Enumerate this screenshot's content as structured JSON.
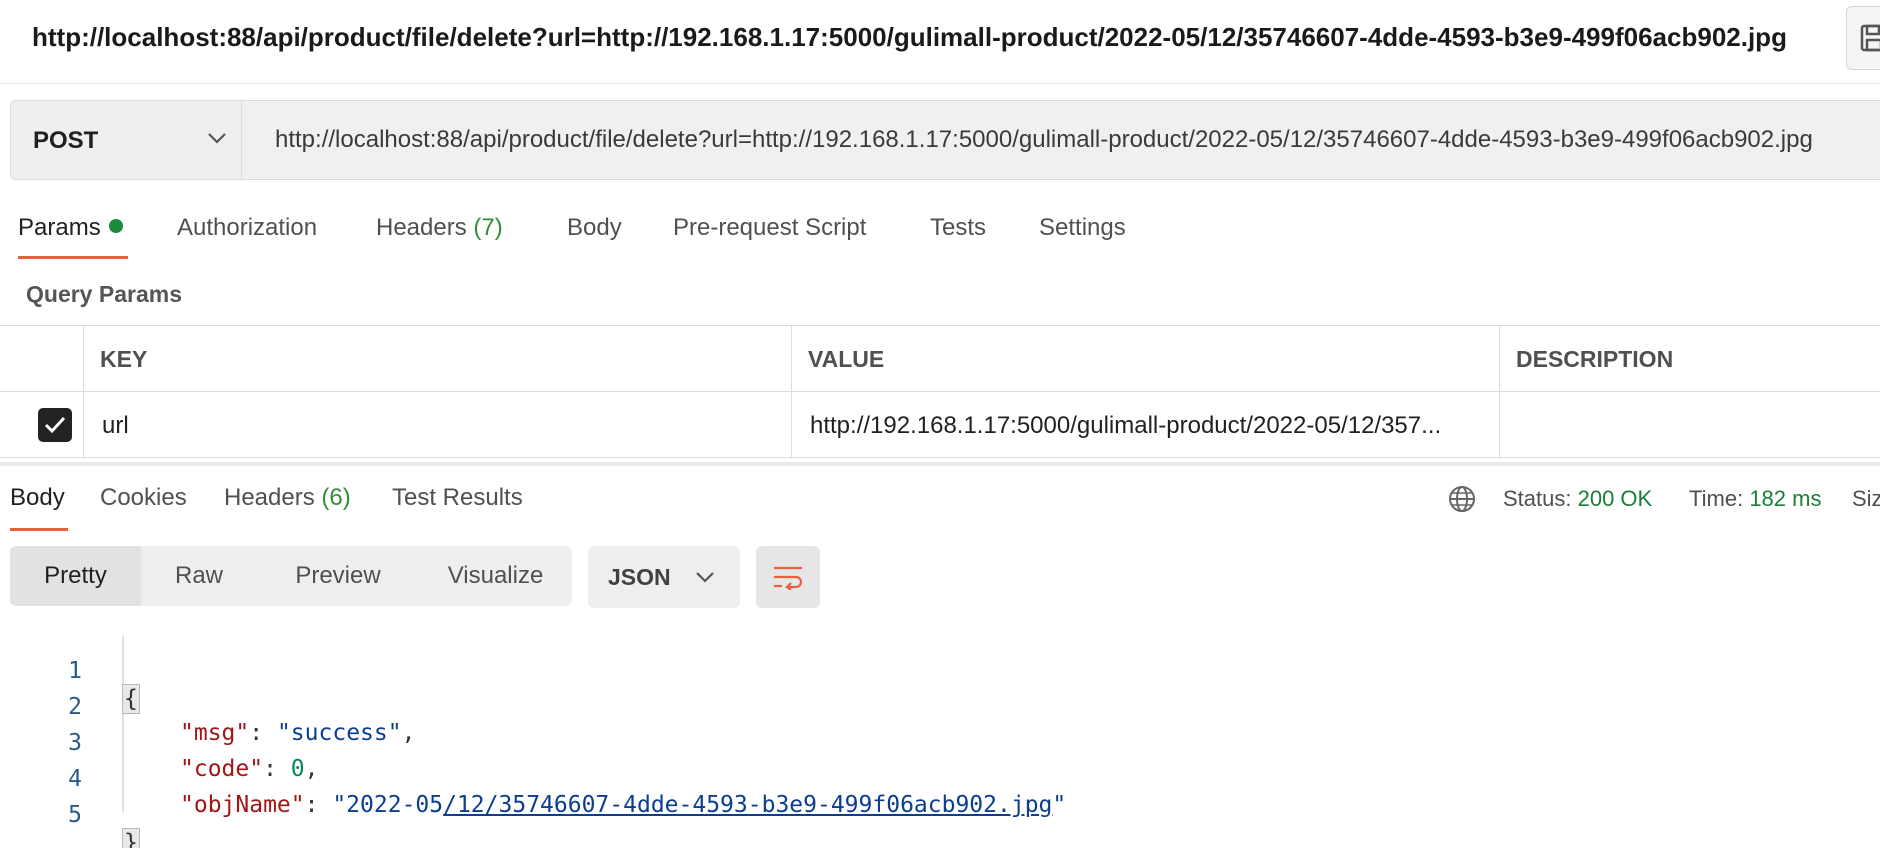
{
  "window": {
    "title": "http://localhost:88/api/product/file/delete?url=http://192.168.1.17:5000/gulimall-product/2022-05/12/35746607-4dde-4593-b3e9-499f06acb902.jpg"
  },
  "request": {
    "method": "POST",
    "url": "http://localhost:88/api/product/file/delete?url=http://192.168.1.17:5000/gulimall-product/2022-05/12/35746607-4dde-4593-b3e9-499f06acb902.jpg"
  },
  "request_tabs": {
    "params": "Params",
    "authorization": "Authorization",
    "headers": "Headers",
    "headers_count": "(7)",
    "body": "Body",
    "prerequest": "Pre-request Script",
    "tests": "Tests",
    "settings": "Settings"
  },
  "query_params": {
    "section_title": "Query Params",
    "columns": {
      "key": "KEY",
      "value": "VALUE",
      "description": "DESCRIPTION"
    },
    "rows": [
      {
        "checked": true,
        "key": "url",
        "value": "http://192.168.1.17:5000/gulimall-product/2022-05/12/357...",
        "description": ""
      }
    ]
  },
  "response_tabs": {
    "body": "Body",
    "cookies": "Cookies",
    "headers": "Headers",
    "headers_count": "(6)",
    "test_results": "Test Results"
  },
  "response_status": {
    "status_label": "Status:",
    "status_value": "200 OK",
    "time_label": "Time:",
    "time_value": "182 ms",
    "size_label": "Siz"
  },
  "view_modes": {
    "pretty": "Pretty",
    "raw": "Raw",
    "preview": "Preview",
    "visualize": "Visualize"
  },
  "format": {
    "selected": "JSON"
  },
  "response_body": {
    "line_numbers": [
      "1",
      "2",
      "3",
      "4",
      "5"
    ],
    "open_brace": "{",
    "close_brace": "}",
    "msg_key": "\"msg\"",
    "msg_value": "\"success\"",
    "code_key": "\"code\"",
    "code_value": "0",
    "objname_key": "\"objName\"",
    "objname_value_prefix": "\"2022-05",
    "objname_value_link": "/12/35746607-4dde-4593-b3e9-499f06acb902.jpg",
    "objname_value_suffix": "\""
  },
  "colors": {
    "accent": "#e8613c",
    "success": "#1a7f37",
    "json_key": "#a31515",
    "json_string": "#0b3e91",
    "json_number": "#098658"
  },
  "icons": {
    "save": "save-icon",
    "method_dropdown": "chevron-down-icon",
    "globe": "globe-icon",
    "wrap": "wrap-lines-icon",
    "checkbox": "checkmark-icon"
  }
}
